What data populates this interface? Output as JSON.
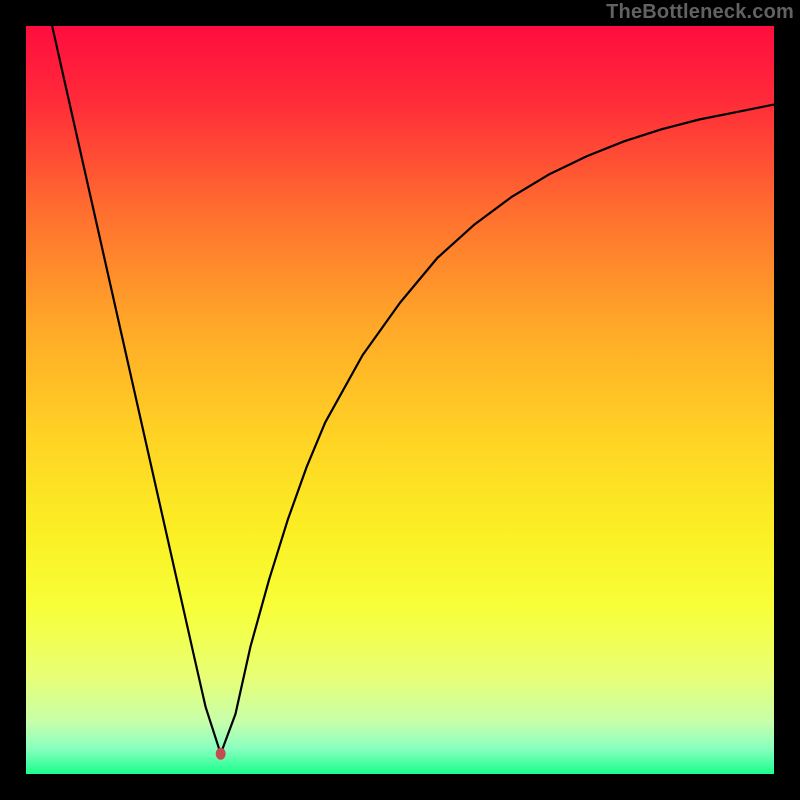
{
  "watermark": "TheBottleneck.com",
  "chart_data": {
    "type": "line",
    "title": "",
    "xlabel": "",
    "ylabel": "",
    "xlim": [
      0,
      100
    ],
    "ylim": [
      0,
      100
    ],
    "grid": false,
    "legend": false,
    "background_gradient_stops": [
      {
        "offset": 0,
        "color": "#ff0d3e"
      },
      {
        "offset": 0.1,
        "color": "#ff2b39"
      },
      {
        "offset": 0.25,
        "color": "#ff6f2f"
      },
      {
        "offset": 0.4,
        "color": "#ffa828"
      },
      {
        "offset": 0.55,
        "color": "#ffd324"
      },
      {
        "offset": 0.68,
        "color": "#fbf024"
      },
      {
        "offset": 0.78,
        "color": "#f7ff3a"
      },
      {
        "offset": 0.87,
        "color": "#e8ff75"
      },
      {
        "offset": 0.93,
        "color": "#c7ffaa"
      },
      {
        "offset": 0.965,
        "color": "#8bffc0"
      },
      {
        "offset": 1.0,
        "color": "#1aff8d"
      }
    ],
    "series": [
      {
        "name": "curve",
        "x": [
          3.5,
          5,
          7.5,
          10,
          12.5,
          15,
          17.5,
          20,
          22.5,
          24,
          26.03,
          28,
          30,
          32.5,
          35,
          37.5,
          40,
          45,
          50,
          55,
          60,
          65,
          70,
          75,
          80,
          85,
          90,
          95,
          100
        ],
        "values": [
          100,
          93.3,
          82.2,
          71.1,
          60,
          48.9,
          37.8,
          26.7,
          15.6,
          9,
          2.7,
          8,
          17,
          26,
          34,
          41,
          47,
          56,
          63,
          69,
          73.5,
          77.2,
          80.2,
          82.6,
          84.6,
          86.2,
          87.5,
          88.5,
          89.5
        ]
      }
    ],
    "marker": {
      "x": 26.03,
      "y": 2.7,
      "rx": 5,
      "ry": 6,
      "color": "#c44c4c"
    }
  }
}
